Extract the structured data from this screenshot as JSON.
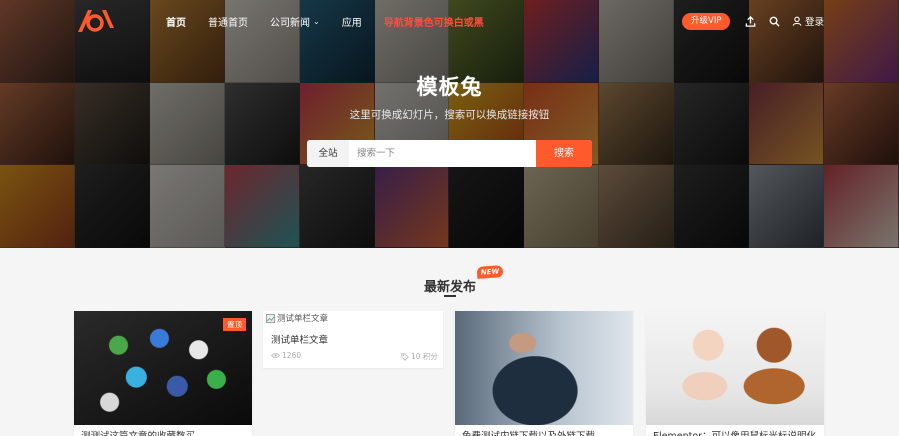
{
  "nav": {
    "items": [
      {
        "label": "首页"
      },
      {
        "label": "普通首页"
      },
      {
        "label": "公司新闻"
      },
      {
        "label": "应用"
      },
      {
        "label": "导航背景色可换白或黑"
      }
    ],
    "vip_label": "升级VIP",
    "login_label": "登录"
  },
  "hero": {
    "title": "模板兔",
    "subtitle": "这里可换成幻灯片，搜索可以换成链接按钮",
    "search": {
      "scope": "全站",
      "placeholder": "搜索一下",
      "button": "搜索"
    }
  },
  "section": {
    "title": "最新发布",
    "badge": "NEW"
  },
  "posts": [
    {
      "title": "测测试这篇文章的收藏数买",
      "badge": "置顶"
    },
    {
      "image_alt": "测试单栏文章",
      "title": "测试单栏文章",
      "views": "1260",
      "points": "10 积分"
    },
    {
      "title": "免费测试内链下载以及外链下载"
    },
    {
      "title": "Elementor：可以像用鼠标光标说明化、变"
    }
  ],
  "colors": {
    "accent": "#ff5a2c",
    "nav_highlight": "#ff4d3c"
  },
  "icons": [
    "logo",
    "chevron-down-icon",
    "upload-icon",
    "search-icon",
    "user-icon",
    "broken-image-icon",
    "eye-icon",
    "tag-icon"
  ]
}
